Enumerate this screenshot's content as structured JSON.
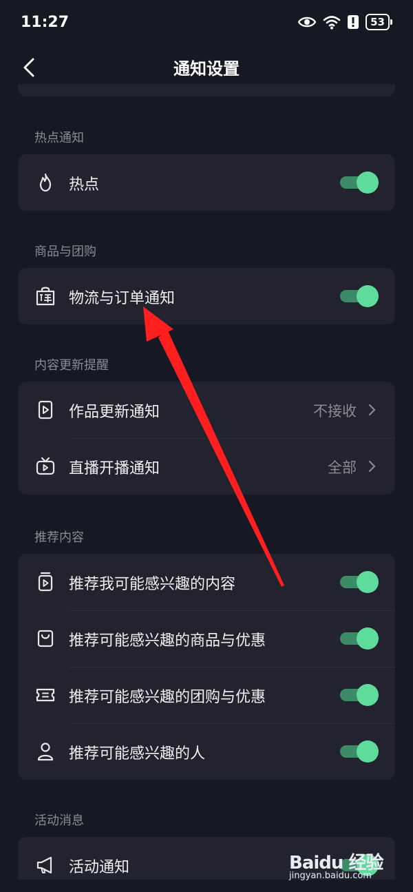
{
  "status_bar": {
    "time": "11:27",
    "battery": "53"
  },
  "header": {
    "title": "通知设置"
  },
  "sections": [
    {
      "title": "热点通知",
      "rows": [
        {
          "icon": "fire-icon",
          "label": "热点",
          "control": "toggle",
          "toggle_on": true
        }
      ]
    },
    {
      "title": "商品与团购",
      "rows": [
        {
          "icon": "order-bag-icon",
          "label": "物流与订单通知",
          "control": "toggle",
          "toggle_on": true
        }
      ]
    },
    {
      "title": "内容更新提醒",
      "rows": [
        {
          "icon": "video-doc-icon",
          "label": "作品更新通知",
          "control": "link",
          "value": "不接收"
        },
        {
          "icon": "tv-live-icon",
          "label": "直播开播通知",
          "control": "link",
          "value": "全部"
        }
      ]
    },
    {
      "title": "推荐内容",
      "rows": [
        {
          "icon": "content-icon",
          "label": "推荐我可能感兴趣的内容",
          "control": "toggle",
          "toggle_on": true
        },
        {
          "icon": "shopping-bag-icon",
          "label": "推荐可能感兴趣的商品与优惠",
          "control": "toggle",
          "toggle_on": true
        },
        {
          "icon": "ticket-icon",
          "label": "推荐可能感兴趣的团购与优惠",
          "control": "toggle",
          "toggle_on": true
        },
        {
          "icon": "person-icon",
          "label": "推荐可能感兴趣的人",
          "control": "toggle",
          "toggle_on": true
        }
      ]
    },
    {
      "title": "活动消息",
      "rows": [
        {
          "icon": "megaphone-icon",
          "label": "活动通知",
          "control": "toggle",
          "toggle_on": true
        }
      ]
    }
  ],
  "watermark": {
    "logo": "Baidu 经验",
    "url": "jingyan.baidu.com"
  },
  "colors": {
    "background": "#161823",
    "card": "#22232e",
    "toggle_on": "#5edc9c",
    "annotation_arrow": "#ff1f1f"
  }
}
